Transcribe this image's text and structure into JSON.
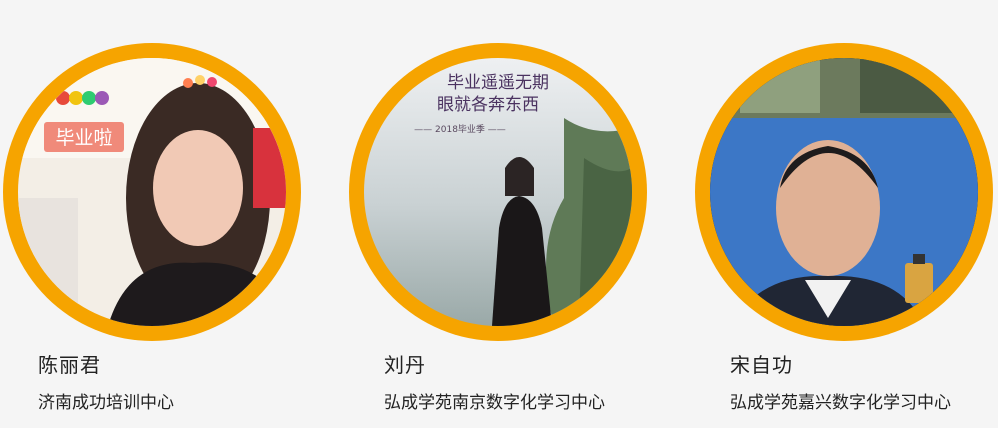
{
  "people": [
    {
      "name": "陈丽君",
      "org": "济南成功培训中心",
      "photo_caption": "毕业啦"
    },
    {
      "name": "刘丹",
      "org": "弘成学苑南京数字化学习中心",
      "photo_caption_line1": "毕业遥遥无期",
      "photo_caption_line2": "眼就各奔东西",
      "photo_caption_small": "—— 2018毕业季 ——"
    },
    {
      "name": "宋自功",
      "org": "弘成学苑嘉兴数字化学习中心"
    }
  ],
  "colors": {
    "ring": "#f6a400",
    "background": "#f5f5f5",
    "text": "#222222"
  }
}
